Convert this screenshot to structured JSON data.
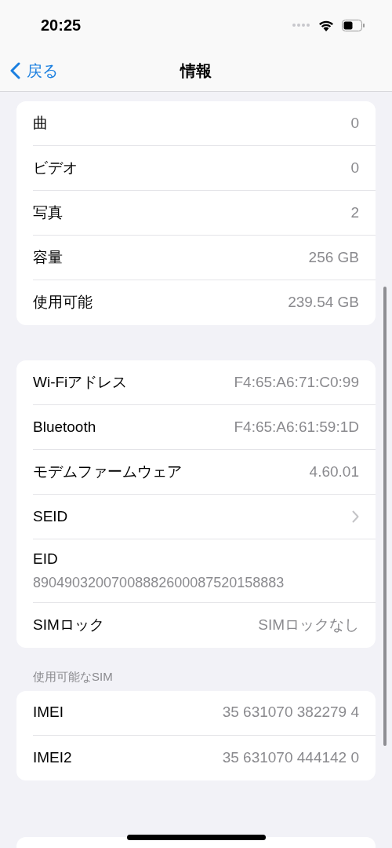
{
  "status_bar": {
    "time": "20:25"
  },
  "nav": {
    "back": "戻る",
    "title": "情報"
  },
  "sections": [
    {
      "rows": [
        {
          "kind": "value",
          "label": "曲",
          "value": "0"
        },
        {
          "kind": "value",
          "label": "ビデオ",
          "value": "0"
        },
        {
          "kind": "value",
          "label": "写真",
          "value": "2"
        },
        {
          "kind": "value",
          "label": "容量",
          "value": "256 GB"
        },
        {
          "kind": "value",
          "label": "使用可能",
          "value": "239.54 GB"
        }
      ]
    },
    {
      "rows": [
        {
          "kind": "value",
          "label": "Wi-Fiアドレス",
          "value": "F4:65:A6:71:C0:99"
        },
        {
          "kind": "value",
          "label": "Bluetooth",
          "value": "F4:65:A6:61:59:1D"
        },
        {
          "kind": "value",
          "label": "モデムファームウェア",
          "value": "4.60.01"
        },
        {
          "kind": "disclosure",
          "label": "SEID"
        },
        {
          "kind": "stacked",
          "label": "EID",
          "value": "89049032007008882600087520158883"
        },
        {
          "kind": "value",
          "label": "SIMロック",
          "value": "SIMロックなし"
        }
      ]
    },
    {
      "header": "使用可能なSIM",
      "rows": [
        {
          "kind": "value",
          "label": "IMEI",
          "value": "35 631070 382279 4"
        },
        {
          "kind": "value",
          "label": "IMEI2",
          "value": "35 631070 444142 0"
        }
      ]
    }
  ]
}
